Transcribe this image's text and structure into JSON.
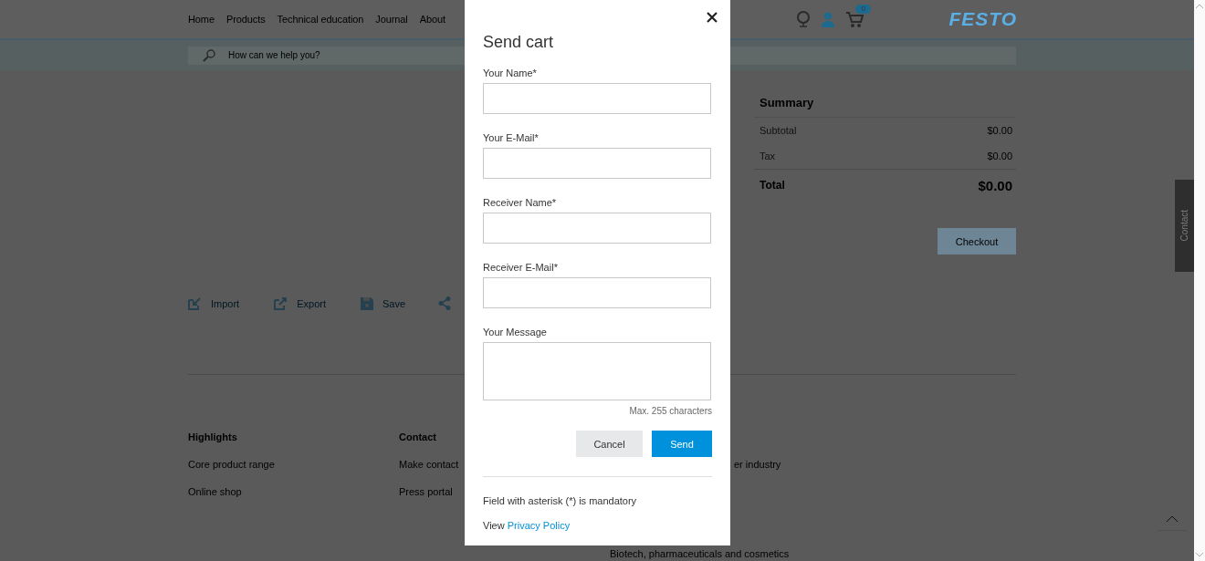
{
  "header": {
    "nav": [
      "Home",
      "Products",
      "Technical education",
      "Journal",
      "About"
    ],
    "logo": "FESTO",
    "cart_count": "0",
    "search": {
      "placeholder": "How can we help you?"
    }
  },
  "cart_actions": [
    {
      "label": "Import",
      "kind": "import"
    },
    {
      "label": "Export",
      "kind": "export"
    },
    {
      "label": "Save",
      "kind": "save"
    }
  ],
  "summary": {
    "title": "Summary",
    "rows": [
      {
        "label": "Subtotal",
        "value": "$0.00",
        "kind": "line"
      },
      {
        "label": "Tax",
        "value": "$0.00",
        "kind": "line"
      },
      {
        "label": "Total",
        "value": "$0.00",
        "kind": "total"
      }
    ],
    "checkout": "Checkout"
  },
  "footer": {
    "columns": [
      {
        "title": "Highlights",
        "items": [
          "Core product range",
          "Online shop"
        ]
      },
      {
        "title": "Contact",
        "items": [
          "Make contact",
          "Press portal"
        ]
      },
      {
        "items": [
          "er industry",
          "Biotech, pharmaceuticals and cosmetics"
        ]
      }
    ]
  },
  "contact_tab": "Contact",
  "dialog": {
    "title": "Send cart",
    "fields": [
      {
        "label": "Your Name*",
        "kind": "input"
      },
      {
        "label": "Your E-Mail*",
        "kind": "input"
      },
      {
        "label": "Receiver Name*",
        "kind": "input"
      },
      {
        "label": "Receiver E-Mail*",
        "kind": "input"
      },
      {
        "label": "Your Message",
        "kind": "textarea"
      }
    ],
    "hint": "Max. 255 characters",
    "buttons": [
      {
        "label": "Cancel",
        "kind": "secondary"
      },
      {
        "label": "Send",
        "kind": "primary"
      }
    ],
    "note": "Field with asterisk (*) is mandatory",
    "privacy": {
      "prefix": "View",
      "link": "Privacy Policy"
    }
  }
}
